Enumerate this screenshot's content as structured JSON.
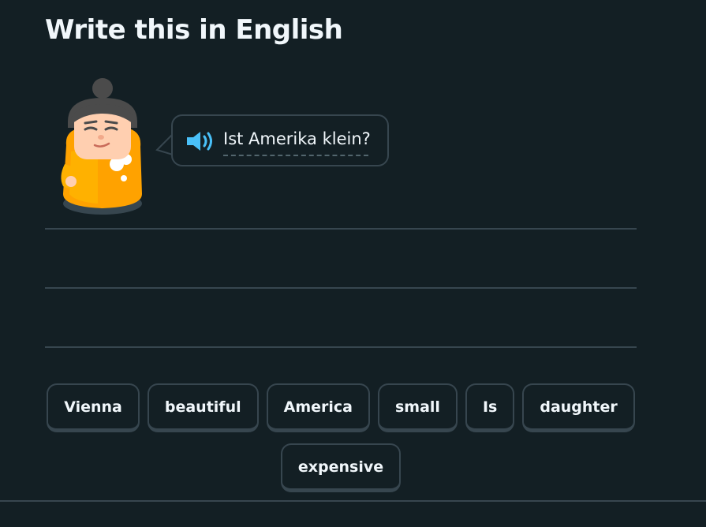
{
  "header": {
    "title": "Write this in English"
  },
  "prompt": {
    "text": "Ist Amerika klein?",
    "speaker_icon": "speaker-icon"
  },
  "word_bank": [
    "Vienna",
    "beautiful",
    "America",
    "small",
    "Is",
    "daughter",
    "expensive"
  ],
  "colors": {
    "background": "#131f24",
    "text": "#f1f7fb",
    "border": "#37464f",
    "speaker": "#49c0f8",
    "character_body": "#ffa200",
    "character_skin": "#ffcfb0",
    "character_hair": "#4b4b4b"
  }
}
